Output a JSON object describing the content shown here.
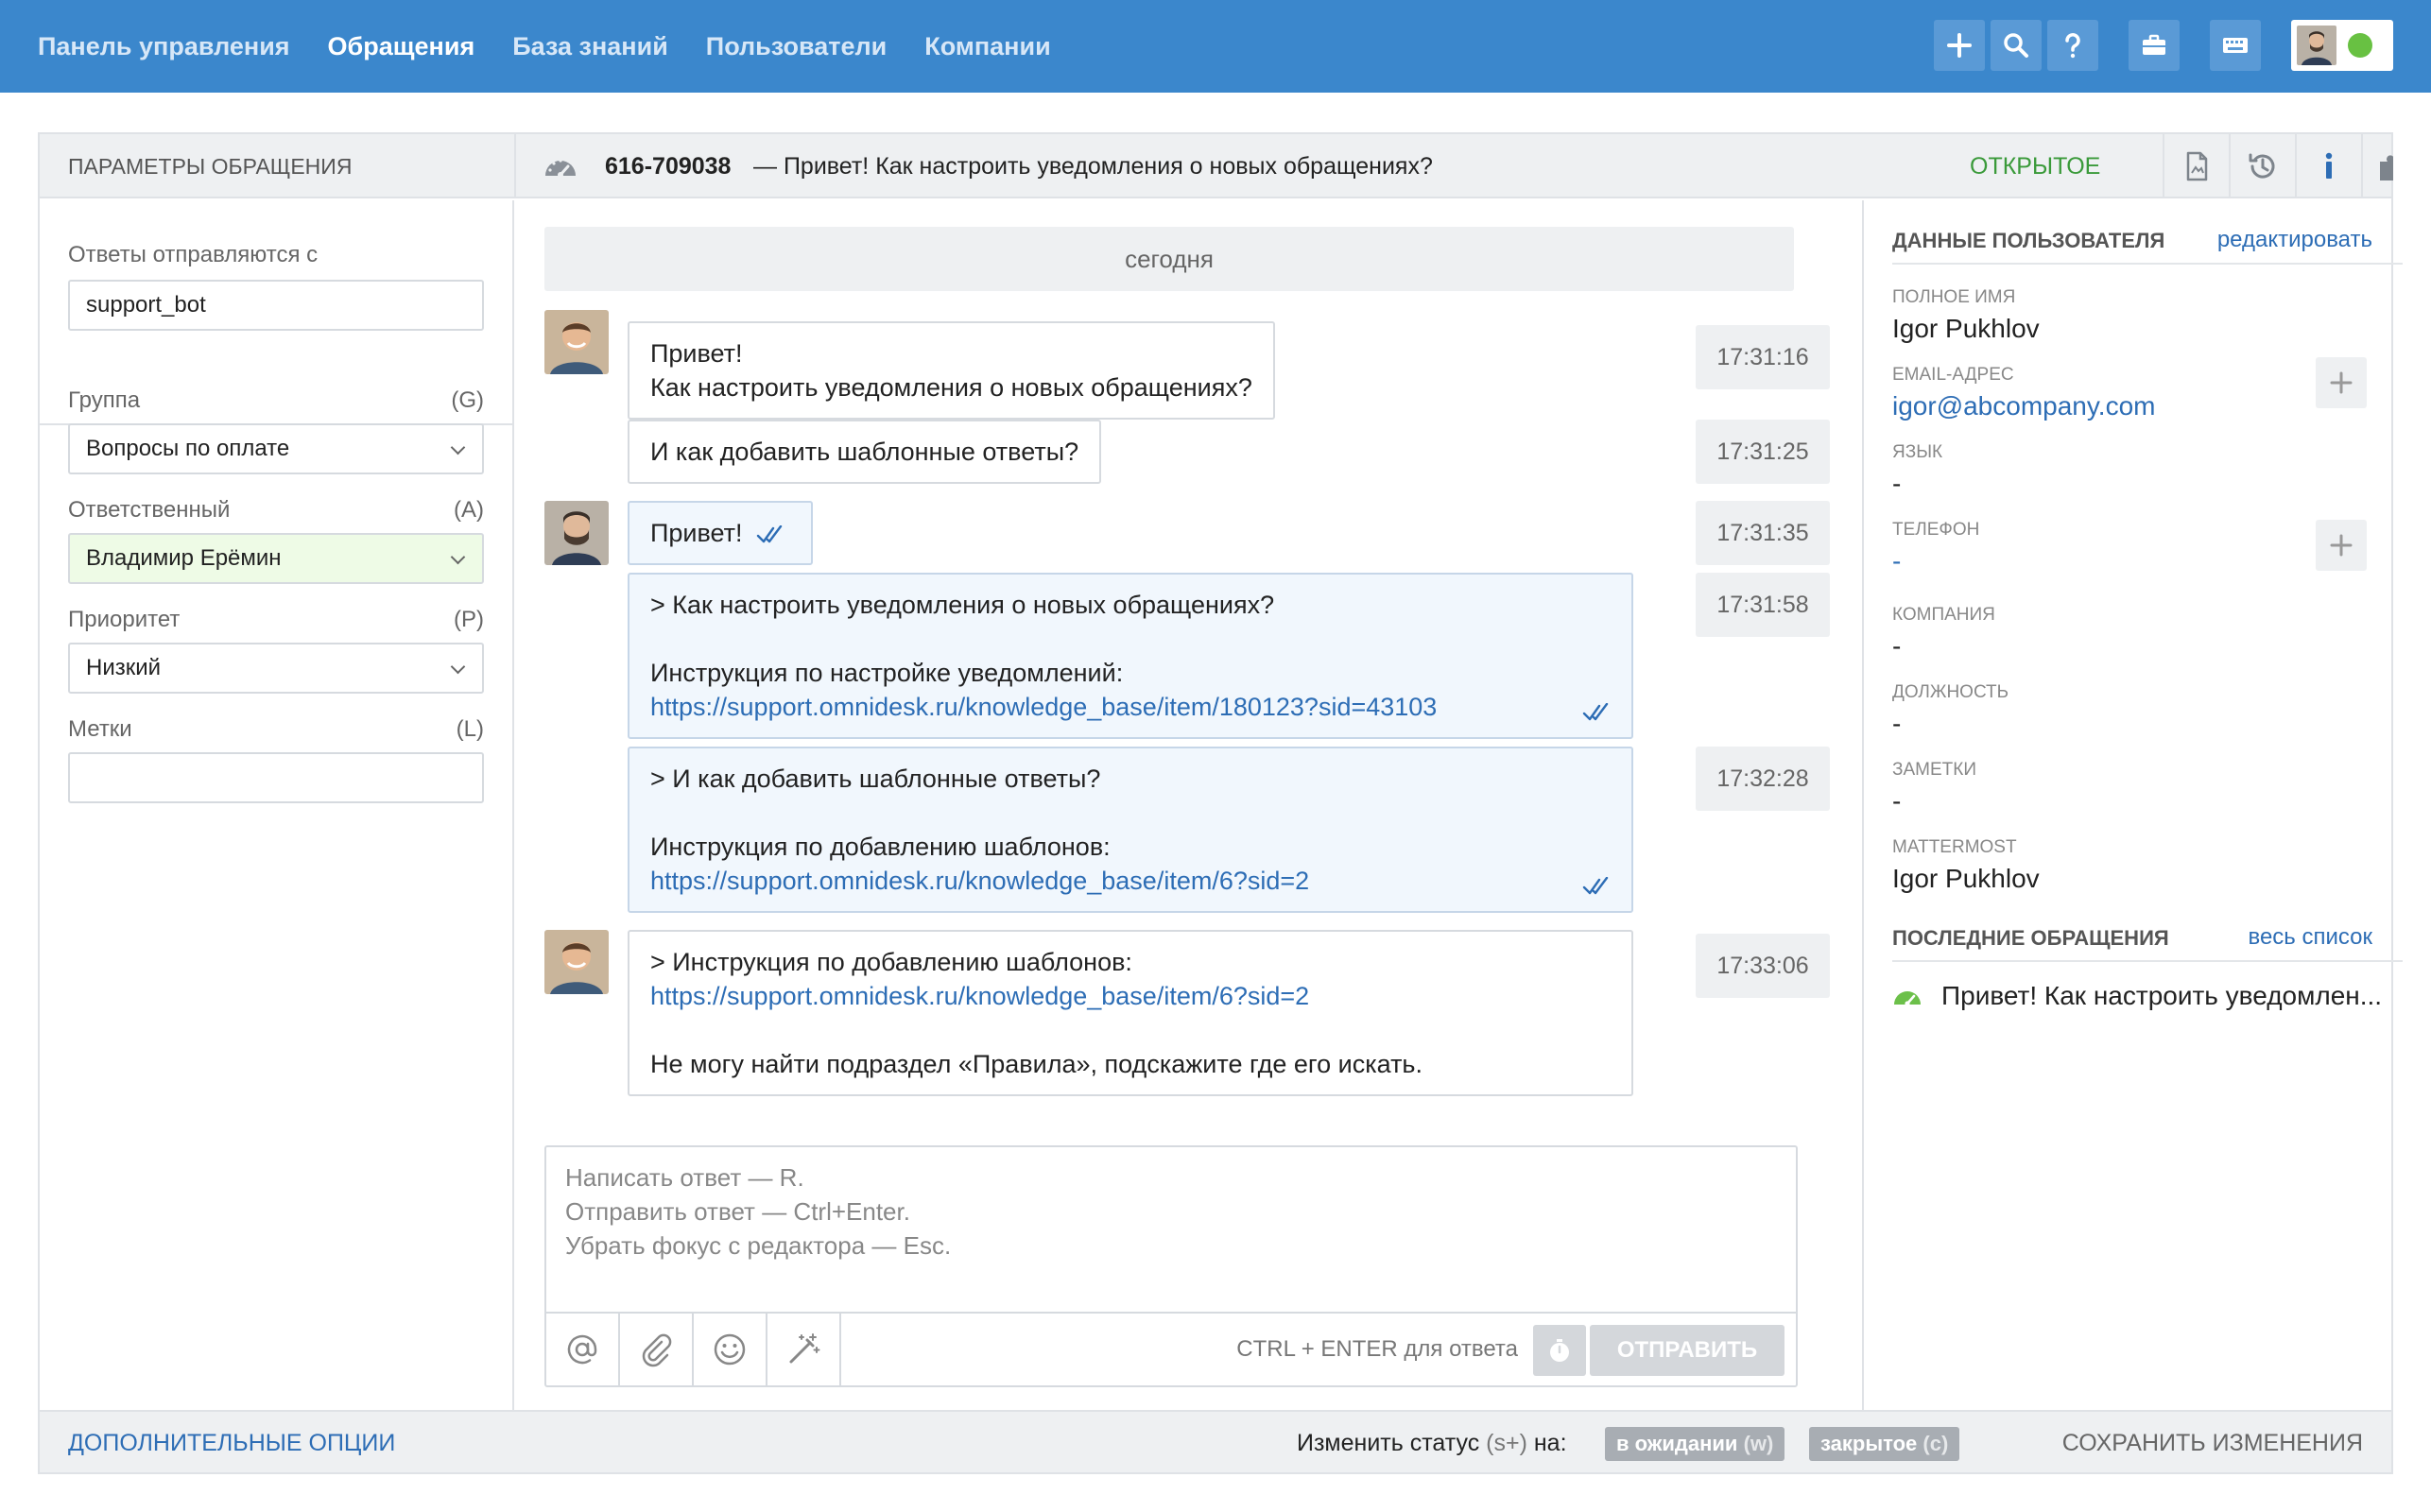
{
  "nav": {
    "items": [
      {
        "label": "Панель управления",
        "active": false
      },
      {
        "label": "Обращения",
        "active": true
      },
      {
        "label": "База знаний",
        "active": false
      },
      {
        "label": "Пользователи",
        "active": false
      },
      {
        "label": "Компании",
        "active": false
      }
    ],
    "tools": [
      "plus-icon",
      "search-icon",
      "help-icon",
      "briefcase-icon",
      "keyboard-icon"
    ],
    "online_color": "#68c142"
  },
  "header": {
    "params_title": "ПАРАМЕТРЫ ОБРАЩЕНИЯ",
    "ticket_number": "616-709038",
    "ticket_subject": "— Привет! Как настроить уведомления о новых обращениях?",
    "status": "ОТКРЫТОЕ",
    "status_color": "#3a9a3a",
    "icons": [
      "document-icon",
      "history-icon",
      "info-icon",
      "puzzle-icon"
    ]
  },
  "params": {
    "reply_from_label": "Ответы отправляются с",
    "reply_from_value": "support_bot",
    "group_label": "Группа",
    "group_key": "(G)",
    "group_value": "Вопросы по оплате",
    "assignee_label": "Ответственный",
    "assignee_key": "(A)",
    "assignee_value": "Владимир Ерёмин",
    "priority_label": "Приоритет",
    "priority_key": "(P)",
    "priority_value": "Низкий",
    "tags_label": "Метки",
    "tags_key": "(L)",
    "tags_value": ""
  },
  "chat": {
    "day": "сегодня",
    "messages": [
      {
        "dir": "in",
        "lines": [
          "Привет!",
          "Как настроить уведомления о новых обращениях?"
        ],
        "time": "17:31:16"
      },
      {
        "dir": "in",
        "lines": [
          "И как добавить шаблонные ответы?"
        ],
        "time": "17:31:25"
      },
      {
        "dir": "out",
        "lines": [
          "Привет!"
        ],
        "time": "17:31:35"
      },
      {
        "dir": "out",
        "lines": [
          "> Как настроить уведомления о новых обращениях?",
          "",
          "Инструкция по настройке уведомлений:",
          "https://support.omnidesk.ru/knowledge_base/item/180123?sid=43103"
        ],
        "time": "17:31:58"
      },
      {
        "dir": "out",
        "lines": [
          "> И как добавить шаблонные ответы?",
          "",
          "Инструкция по добавлению шаблонов:",
          "https://support.omnidesk.ru/knowledge_base/item/6?sid=2"
        ],
        "time": "17:32:28"
      },
      {
        "dir": "in",
        "lines": [
          "> Инструкция по добавлению шаблонов:",
          "https://support.omnidesk.ru/knowledge_base/item/6?sid=2",
          "",
          "Не могу найти подраздел «Правила», подскажите где его искать."
        ],
        "time": "17:33:06"
      }
    ]
  },
  "editor": {
    "placeholder_lines": [
      "Написать ответ — R.",
      "Отправить ответ — Ctrl+Enter.",
      "Убрать фокус с редактора — Esc."
    ],
    "tools": [
      "mention-icon",
      "attach-icon",
      "emoji-icon",
      "magic-wand-icon"
    ],
    "hint": "CTRL + ENTER для ответа",
    "send_label": "ОТПРАВИТЬ"
  },
  "user": {
    "section_title": "ДАННЫЕ ПОЛЬЗОВАТЕЛЯ",
    "edit_link": "редактировать",
    "fullname_label": "ПОЛНОЕ ИМЯ",
    "fullname": "Igor Pukhlov",
    "email_label": "EMAIL-АДРЕС",
    "email": "igor@abcompany.com",
    "lang_label": "ЯЗЫК",
    "lang": "-",
    "phone_label": "ТЕЛЕФОН",
    "phone": "-",
    "company_label": "КОМПАНИЯ",
    "company": "-",
    "position_label": "ДОЛЖНОСТЬ",
    "position": "-",
    "notes_label": "ЗАМЕТКИ",
    "notes": "-",
    "mattermost_label": "MATTERMOST",
    "mattermost": "Igor Pukhlov",
    "recent_title": "ПОСЛЕДНИЕ ОБРАЩЕНИЯ",
    "recent_link": "весь список",
    "recent_item": "Привет! Как настроить уведомлен..."
  },
  "footer": {
    "more_options": "ДОПОЛНИТЕЛЬНЫЕ ОПЦИИ",
    "change_status_prefix": "Изменить статус",
    "change_status_key": "(s+)",
    "change_status_suffix": "на:",
    "status_pending": "в ожидании",
    "status_pending_key": "(w)",
    "status_closed": "закрытое",
    "status_closed_key": "(c)",
    "save": "СОХРАНИТЬ ИЗМЕНЕНИЯ"
  }
}
